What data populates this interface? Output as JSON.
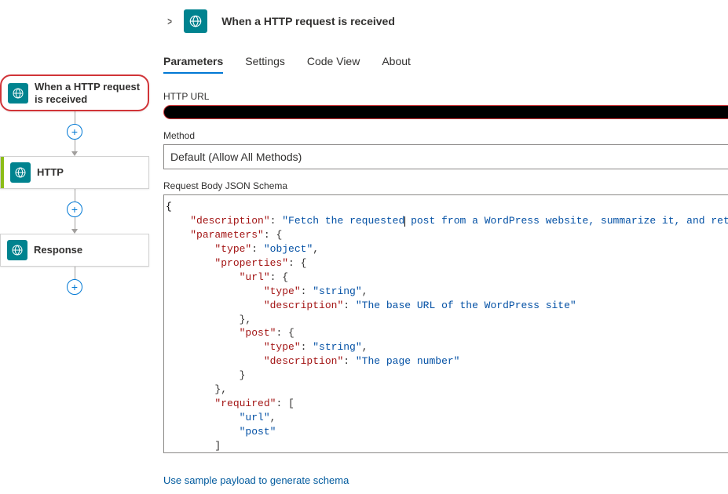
{
  "canvas": {
    "node1": {
      "label": "When a HTTP request is received"
    },
    "node2": {
      "label": "HTTP"
    },
    "node3": {
      "label": "Response"
    }
  },
  "panel": {
    "title": "When a HTTP request is received",
    "tabs": {
      "parameters": "Parameters",
      "settings": "Settings",
      "codeview": "Code View",
      "about": "About"
    },
    "url_label": "HTTP URL",
    "method_label": "Method",
    "method_value": "Default (Allow All Methods)",
    "schema_label": "Request Body JSON Schema",
    "sample_link": "Use sample payload to generate schema"
  },
  "schema": {
    "description_key": "\"description\"",
    "description_val_a": "\"Fetch the requested",
    "description_val_b": " post from a WordPress website, summarize it, and return the summary.\"",
    "parameters_key": "\"parameters\"",
    "type_key": "\"type\"",
    "obj_val": "\"object\"",
    "properties_key": "\"properties\"",
    "url_key": "\"url\"",
    "string_val": "\"string\"",
    "desc_key": "\"description\"",
    "url_desc_val": "\"The base URL of the WordPress site\"",
    "post_key": "\"post\"",
    "post_desc_val": "\"The page number\"",
    "required_key": "\"required\"",
    "req_url": "\"url\"",
    "req_post": "\"post\""
  }
}
